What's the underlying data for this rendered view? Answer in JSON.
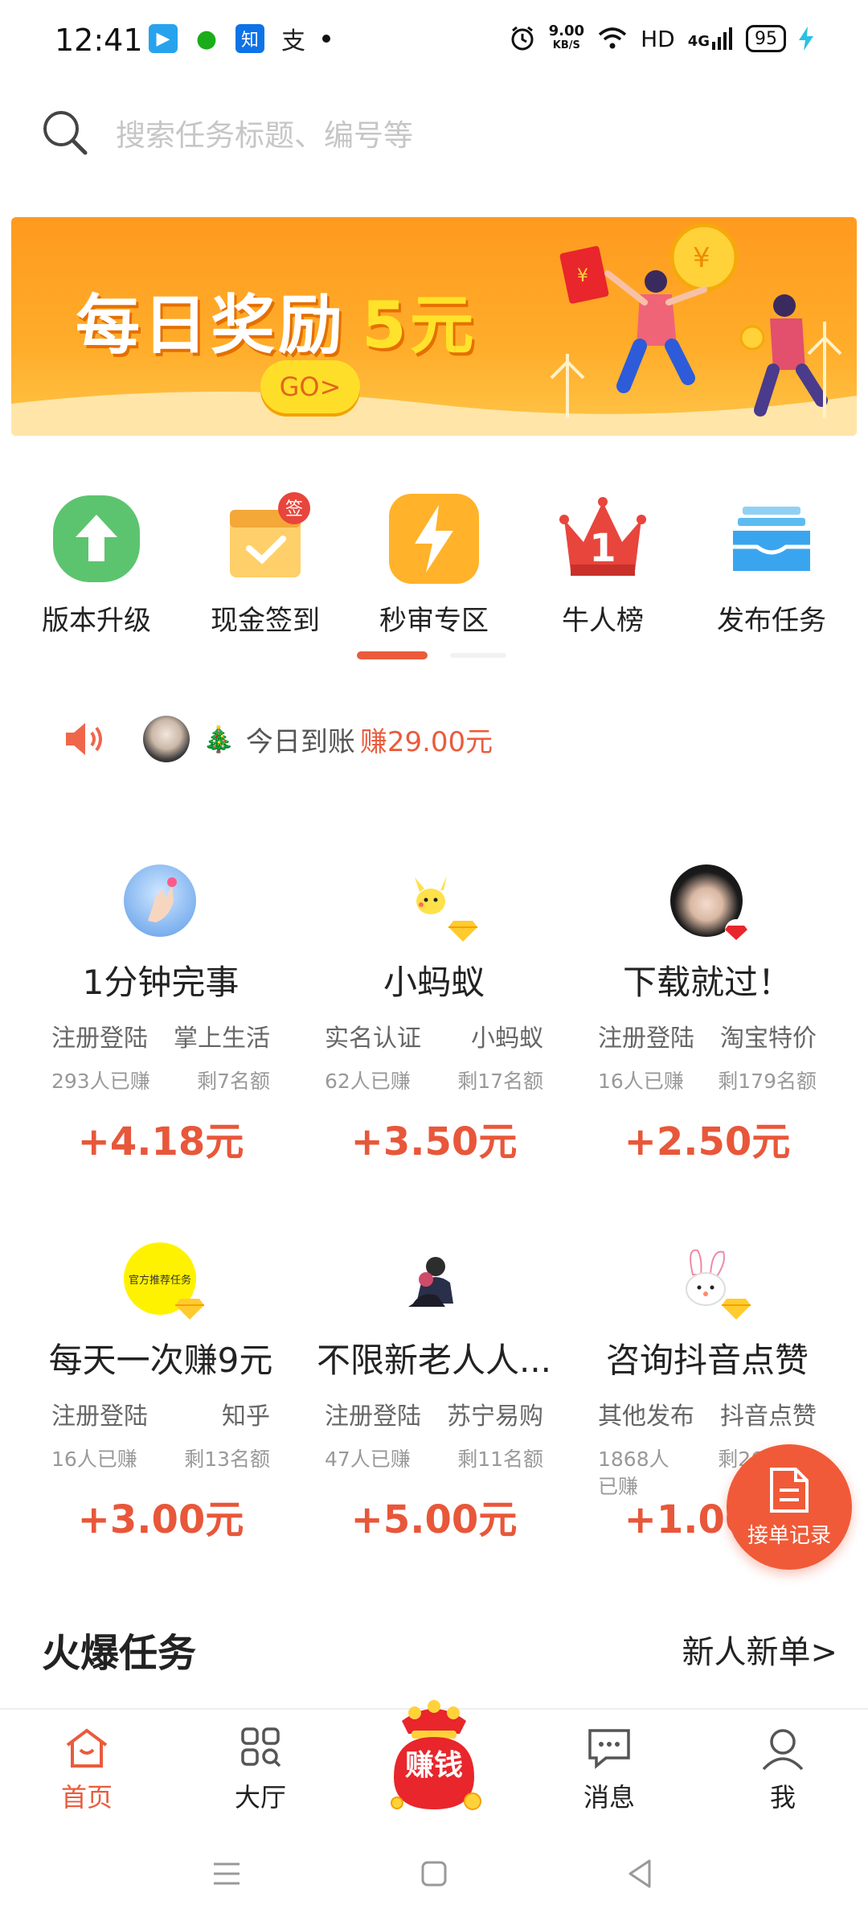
{
  "status_bar": {
    "time": "12:41",
    "speed_value": "9.00",
    "speed_unit": "KB/S",
    "hd": "HD",
    "network": "4G",
    "battery": "95",
    "app_icons": [
      {
        "name": "video-app-icon",
        "glyph": "▶",
        "color": "#27a3ee"
      },
      {
        "name": "wechat-icon",
        "glyph": "●",
        "color": "#1aad19"
      },
      {
        "name": "zhihu-icon",
        "glyph": "知",
        "color": "#0e73e6"
      },
      {
        "name": "alipay-icon",
        "glyph": "支",
        "color": "#222222"
      }
    ]
  },
  "search": {
    "placeholder": "搜索任务标题、编号等"
  },
  "banner": {
    "title": "每日奖励",
    "amount": "5元",
    "button": "GO>"
  },
  "quick_nav": [
    {
      "label": "版本升级",
      "icon": "upgrade-icon"
    },
    {
      "label": "现金签到",
      "icon": "sign-in-calendar-icon",
      "badge": "签"
    },
    {
      "label": "秒审专区",
      "icon": "lightning-icon"
    },
    {
      "label": "牛人榜",
      "icon": "crown-ranking-icon",
      "badge": "1"
    },
    {
      "label": "发布任务",
      "icon": "inbox-publish-icon"
    }
  ],
  "notice": {
    "text": "今日到账",
    "amount": "赚29.00元"
  },
  "tasks": [
    {
      "title": "1分钟完事",
      "tag1": "注册登陆",
      "tag2": "掌上生活",
      "earned": "293人已赚",
      "remaining": "剩7名额",
      "price": "+4.18元"
    },
    {
      "title": "小蚂蚁",
      "tag1": "实名认证",
      "tag2": "小蚂蚁",
      "earned": "62人已赚",
      "remaining": "剩17名额",
      "price": "+3.50元"
    },
    {
      "title": "下载就过！",
      "tag1": "注册登陆",
      "tag2": "淘宝特价",
      "earned": "16人已赚",
      "remaining": "剩179名额",
      "price": "+2.50元"
    },
    {
      "title": "每天一次赚9元",
      "tag1": "注册登陆",
      "tag2": "知乎",
      "earned": "16人已赚",
      "remaining": "剩13名额",
      "price": "+3.00元",
      "avatar_text": "官方推荐任务"
    },
    {
      "title": "不限新老人人...",
      "tag1": "注册登陆",
      "tag2": "苏宁易购",
      "earned": "47人已赚",
      "remaining": "剩11名额",
      "price": "+5.00元"
    },
    {
      "title": "咨询抖音点赞",
      "tag1": "其他发布",
      "tag2": "抖音点赞",
      "earned": "1868人已赚",
      "remaining": "剩267名额",
      "price": "+1.00元"
    }
  ],
  "fab": {
    "label": "接单记录"
  },
  "section": {
    "title": "火爆任务",
    "link": "新人新单>"
  },
  "bottom_nav": [
    {
      "label": "首页",
      "icon": "home-icon",
      "active": true
    },
    {
      "label": "大厅",
      "icon": "grid-hall-icon"
    },
    {
      "label": "赚钱",
      "icon": "money-bag-icon"
    },
    {
      "label": "消息",
      "icon": "message-icon"
    },
    {
      "label": "我",
      "icon": "profile-icon"
    }
  ],
  "colors": {
    "accent": "#ea5b3c",
    "price": "#e8573a",
    "banner": "#ff9a1f"
  }
}
